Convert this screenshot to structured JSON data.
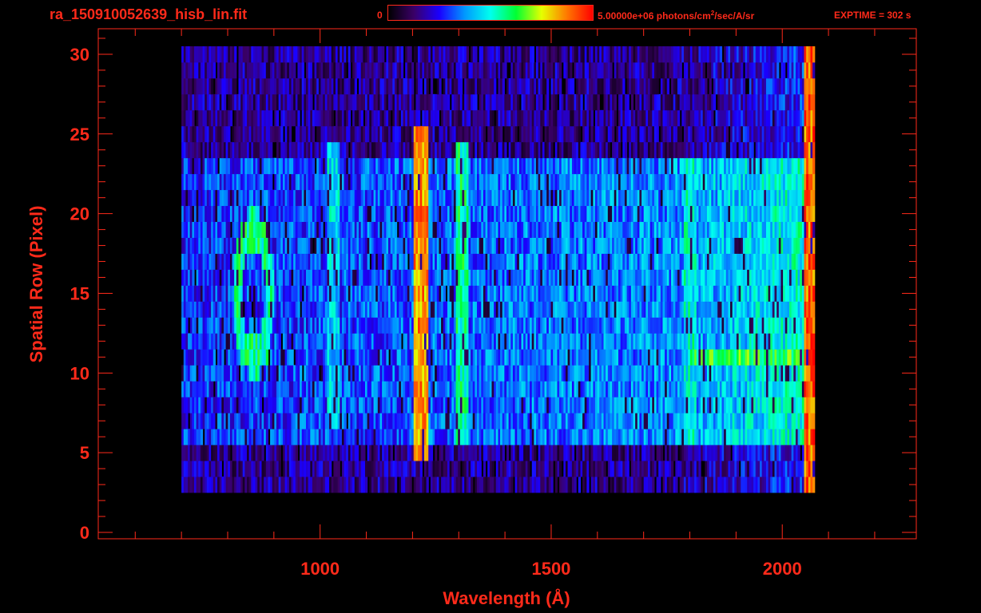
{
  "header": {
    "filename": "ra_150910052639_hisb_lin.fit",
    "colorbar_min": "0",
    "colorbar_max_text": "5.00000e+06 photons/cm",
    "colorbar_max_exp": "2",
    "colorbar_max_suffix": "/sec/A/sr",
    "exptime": "EXPTIME = 302 s"
  },
  "colors": {
    "axis": "#ff2a1a",
    "background": "#000000",
    "colormap": [
      "#000000",
      "#3a0066",
      "#1a00ff",
      "#0099ff",
      "#00ffee",
      "#00ff33",
      "#e6ff00",
      "#ff7700",
      "#ff0000"
    ]
  },
  "chart_data": {
    "type": "heatmap",
    "title": "ra_150910052639_hisb_lin.fit",
    "xlabel": "Wavelength (Å)",
    "ylabel": "Spatial Row (Pixel)",
    "xlim": [
      520,
      2290
    ],
    "ylim": [
      -0.4,
      31.6
    ],
    "xticks": [
      1000,
      1500,
      2000
    ],
    "yticks": [
      0,
      5,
      10,
      15,
      20,
      25,
      30
    ],
    "colorbar": {
      "min": 0,
      "max": 5000000,
      "units": "photons/cm^2/sec/A/sr"
    },
    "data_extent": {
      "x": [
        700,
        2070
      ],
      "rows": [
        3,
        30
      ]
    },
    "bright_features": [
      {
        "x": 1216,
        "rows": [
          5,
          25
        ],
        "level": 0.85,
        "description": "bright vertical line"
      },
      {
        "x": 1304,
        "rows": [
          6,
          24
        ],
        "level": 0.55
      },
      {
        "x": 1025,
        "rows": [
          7,
          24
        ],
        "level": 0.45
      },
      {
        "x": 1800,
        "rows": [
          6,
          23
        ],
        "level": 0.5
      },
      {
        "x": 2060,
        "rows": [
          2,
          30
        ],
        "level": 0.9,
        "description": "red edge line"
      },
      {
        "x": [
          820,
          890
        ],
        "rows": [
          11,
          19
        ],
        "level": 0.55,
        "description": "ring-shaped feature"
      }
    ],
    "bright_rows": [
      {
        "row": 11,
        "x": [
          1800,
          2060
        ],
        "level": 0.62
      }
    ]
  }
}
